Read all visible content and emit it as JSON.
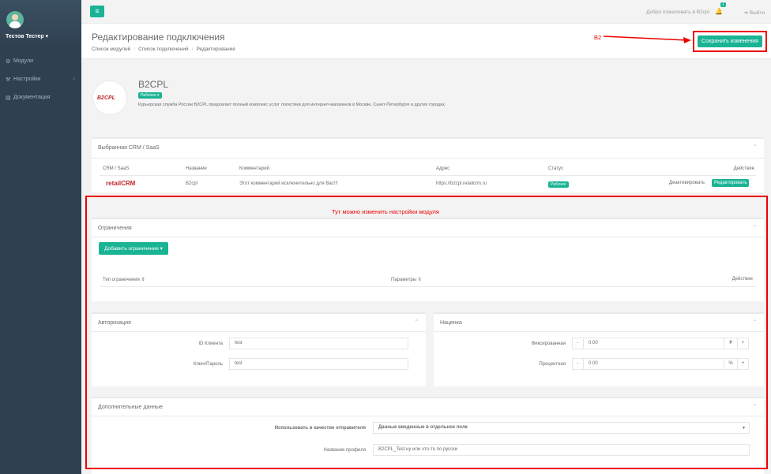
{
  "sidebar": {
    "user_name": "Тестов Тестер ▾",
    "items": [
      {
        "icon": "⚙",
        "label": "Модули"
      },
      {
        "icon": "⚒",
        "label": "Настройки",
        "chevron": "‹"
      },
      {
        "icon": "▤",
        "label": "Документация"
      }
    ]
  },
  "topbar": {
    "menu_icon": "≡",
    "welcome": "Добро пожаловать в B2cpl",
    "bell_icon": "🔔",
    "bell_count": "1",
    "logout": "➜ Выйти"
  },
  "heading": {
    "title": "Редактирование подключения",
    "breadcrumb": [
      "Список модулей",
      "Список подключений",
      "Редактирование"
    ],
    "save_label": "Сохранить изменения"
  },
  "annotations": {
    "b2": "B2",
    "settings_hint": "Тут можно изменить настройки модуля"
  },
  "module": {
    "logo_text": "B2CPL",
    "name": "B2CPL",
    "badge": "Рабочее ▾",
    "description": "Курьерская служба России B2CPL предлагает полный комплекс услуг логистики для интернет-магазинов в Москве, Санкт-Петербурге и других городах."
  },
  "crm_panel": {
    "title": "Выбранная CRM / SaaS",
    "columns": [
      "CRM / SaaS",
      "Название",
      "Комментарий",
      "Адрес",
      "Статус",
      "Действие"
    ],
    "row": {
      "crm_logo": "retailCRM",
      "name": "B2cpl",
      "comment": "Этот комментарий исключительно для Вас!!!",
      "address": "https://b2cpl.retailcrm.ru",
      "status": "Рабочее",
      "deactivate": "Деактивировать",
      "edit": "Редактировать"
    }
  },
  "restrictions_panel": {
    "title": "Ограничения",
    "add_button": "Добавить ограничение ▾",
    "columns": [
      "Тип ограничения ⇕",
      "Параметры ⇕",
      "Действие"
    ]
  },
  "auth_panel": {
    "title": "Авторизация",
    "client_id_label": "ID Клиента",
    "client_id_value": "test",
    "password_label": "Ключ/Пароль",
    "password_value": "test"
  },
  "markup_panel": {
    "title": "Наценка",
    "fixed_label": "Фиксированная",
    "fixed_value": "0.00",
    "fixed_unit": "₽",
    "percent_label": "Процентная",
    "percent_value": "0.00",
    "percent_unit": "%",
    "minus": "-",
    "plus": "+"
  },
  "extra_panel": {
    "title": "Дополнительные данные",
    "sender_label": "Использовать в качестве отправителя",
    "sender_value": "Данные введенные в отдельное поле",
    "profile_label": "Название профиля",
    "profile_value": "B2CPL_Test ну или что-то по русски"
  },
  "colors": {
    "accent": "#1ab394",
    "sidebar": "#2f4050",
    "annotation": "#ee0000"
  }
}
